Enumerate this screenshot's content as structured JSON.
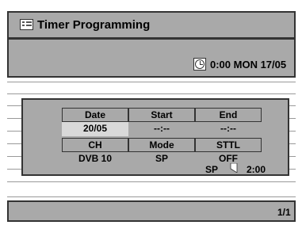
{
  "title": "Timer Programming",
  "clock": "0:00 MON 17/05",
  "table": {
    "headers": {
      "date": "Date",
      "start": "Start",
      "end": "End",
      "ch": "CH",
      "mode": "Mode",
      "sttl": "STTL"
    },
    "values": {
      "date": "20/05",
      "start": "--:--",
      "end": "--:--",
      "ch": "DVB 10",
      "mode": "SP",
      "sttl": "OFF"
    },
    "mode_remaining": "SP",
    "duration": "2:00"
  },
  "page_indicator": "1/1",
  "icons": {
    "title": "timer-list-icon",
    "clock": "clock-icon",
    "duration": "disc-remaining-icon"
  },
  "colors": {
    "panel": "#a9a9a9",
    "border": "#333333",
    "selected_cell": "#d9d9d9"
  }
}
